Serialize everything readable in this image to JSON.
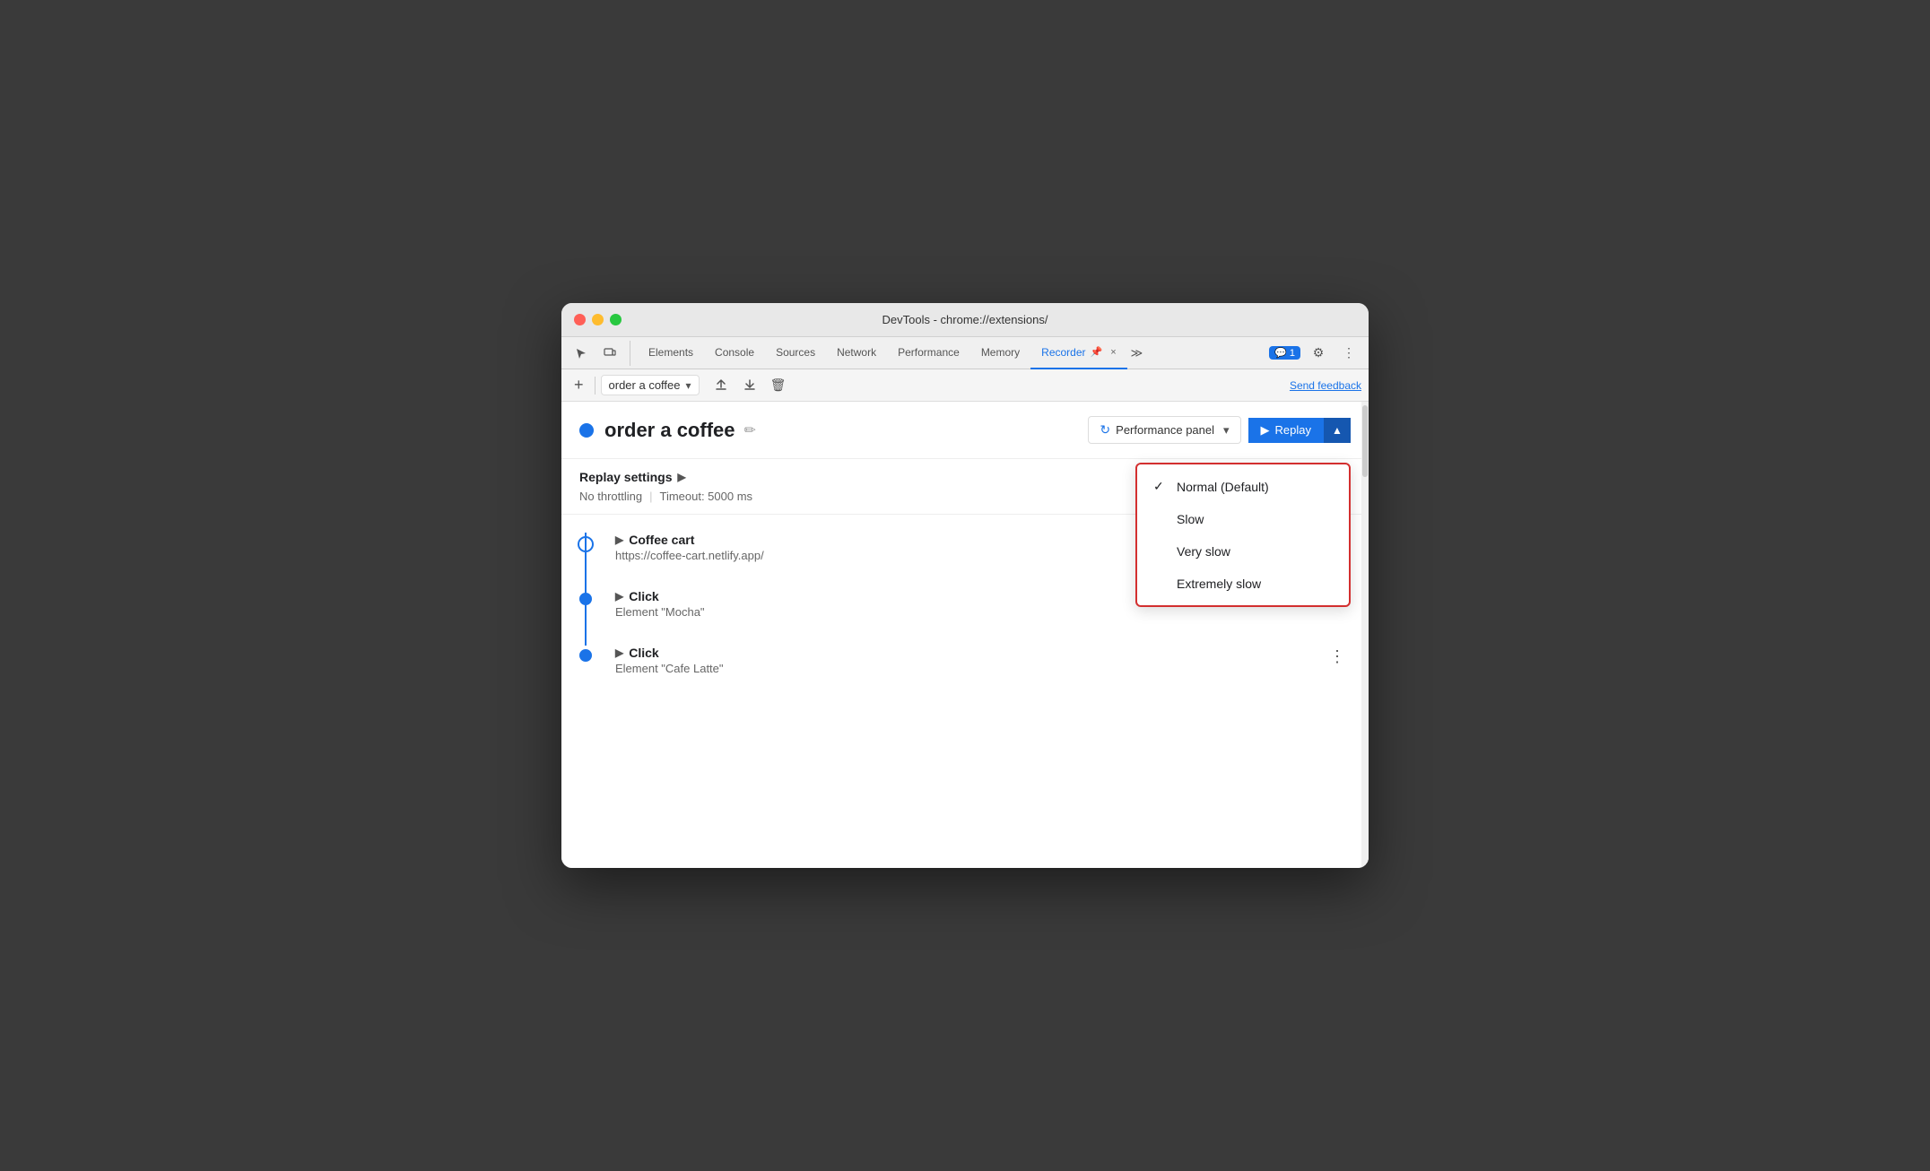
{
  "window": {
    "title": "DevTools - chrome://extensions/"
  },
  "tabs": {
    "items": [
      {
        "label": "Elements",
        "active": false
      },
      {
        "label": "Console",
        "active": false
      },
      {
        "label": "Sources",
        "active": false
      },
      {
        "label": "Network",
        "active": false
      },
      {
        "label": "Performance",
        "active": false
      },
      {
        "label": "Memory",
        "active": false
      },
      {
        "label": "Recorder",
        "active": true
      }
    ],
    "more_icon": "≫",
    "chat_count": "1",
    "pin_icon": "📌",
    "close_icon": "×"
  },
  "toolbar": {
    "add_icon": "+",
    "recording_name": "order a coffee",
    "export_icon": "↑",
    "import_icon": "↓",
    "delete_icon": "🗑",
    "send_feedback": "Send feedback"
  },
  "recording": {
    "title": "order a coffee",
    "edit_icon": "✏",
    "dot_color": "#1a73e8"
  },
  "performance_panel": {
    "label": "Performance panel",
    "icon": "↻"
  },
  "replay_button": {
    "label": "Replay",
    "play_icon": "▶"
  },
  "replay_settings": {
    "header": "Replay settings",
    "arrow": "▶",
    "throttling": "No throttling",
    "timeout": "Timeout: 5000 ms"
  },
  "dropdown": {
    "options": [
      {
        "label": "Normal (Default)",
        "checked": true
      },
      {
        "label": "Slow",
        "checked": false
      },
      {
        "label": "Very slow",
        "checked": false
      },
      {
        "label": "Extremely slow",
        "checked": false
      }
    ],
    "check_mark": "✓"
  },
  "steps": [
    {
      "type": "navigate",
      "title": "Coffee cart",
      "subtitle": "https://coffee-cart.netlify.app/",
      "dot": "open"
    },
    {
      "type": "click",
      "title": "Click",
      "subtitle": "Element \"Mocha\"",
      "dot": "filled"
    },
    {
      "type": "click",
      "title": "Click",
      "subtitle": "Element \"Cafe Latte\"",
      "dot": "filled"
    }
  ]
}
